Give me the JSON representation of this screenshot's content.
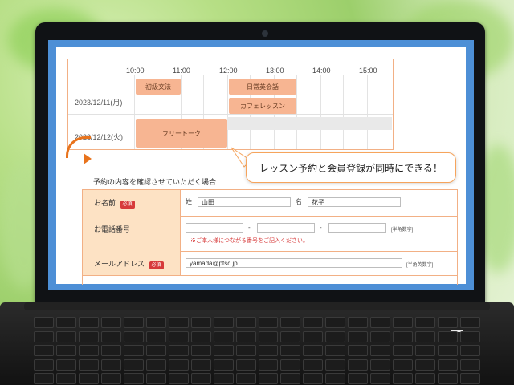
{
  "schedule": {
    "times": [
      "10:00",
      "11:00",
      "12:00",
      "13:00",
      "14:00",
      "15:00"
    ],
    "dates": [
      "2023/12/11(月)",
      "2023/12/12(火)"
    ],
    "slots": [
      {
        "label": "初級文法"
      },
      {
        "label": "日常英会話"
      },
      {
        "label": "カフェレッスン"
      },
      {
        "label": "フリートーク"
      }
    ]
  },
  "callout": {
    "text": "レッスン予約と会員登録が同時にできる！"
  },
  "form": {
    "intro": "予約の内容を確認させていただく場合",
    "required_badge": "必須",
    "name_row": {
      "label": "お名前",
      "last_name_label": "姓",
      "last_name_value": "山田",
      "first_name_label": "名",
      "first_name_value": "花子"
    },
    "phone_row": {
      "label": "お電話番号",
      "separator": "-",
      "hint": "[半角数字]",
      "note": "※ご本人様につながる番号をご記入ください。"
    },
    "email_row": {
      "label": "メールアドレス",
      "value": "yamada@ptsc.jp",
      "hint": "[半角英数字]"
    }
  },
  "colors": {
    "accent": "#e8731c",
    "slot_fill": "#f7b592",
    "label_bg": "#fde2c4",
    "required": "#d73a3a"
  }
}
